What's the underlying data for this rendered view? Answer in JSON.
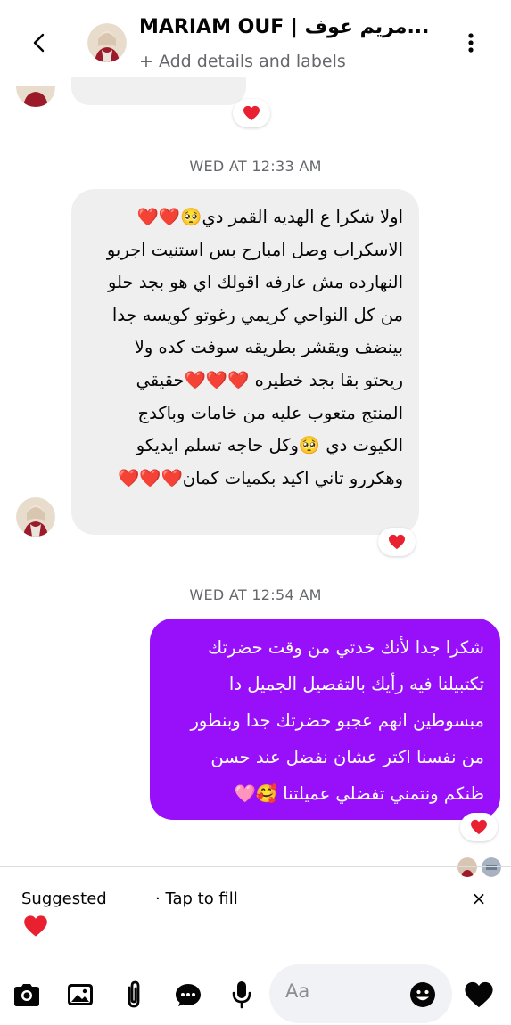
{
  "header": {
    "title": "MARIAM OUF | مريم عوف...",
    "subtitle": "+ Add details and labels"
  },
  "thread": {
    "timestamp_1": "WED AT 12:33 AM",
    "incoming_lines": [
      "اولا شكرا ع الهديه القمر دي🥺❤️❤️",
      "الاسكراب وصل امبارح بس استنيت اجربو",
      "النهارده مش عارفه اقولك اي هو بجد حلو",
      "من كل النواحي كريمي رغوتو كويسه جدا",
      "بينضف ويقشر  بطريقه سوفت كده ولا",
      "ريحتو بقا بجد خطيره ❤️❤️❤️حقيقي",
      "المنتج متعوب عليه من خامات وباكدج",
      "الكيوت دي 🥺وكل حاجه تسلم ايديكو",
      "وهكررو تاني اكيد بكميات كمان❤️❤️❤️"
    ],
    "timestamp_2": "WED AT 12:54 AM",
    "outgoing_lines": [
      "شكرا جدا لأنك خدتي من وقت حضرتك",
      "تكتبيلنا فيه رأيك بالتفصيل الجميل دا",
      "مبسوطين انهم عجبو حضرتك جدا وبنطور",
      "من نفسنا اكتر عشان نفضل عند حسن",
      "ظنكم ونتمني تفضلي عميلتنا 🥰🩷"
    ]
  },
  "suggestions": {
    "label": "Suggested",
    "tap_text": "· Tap to fill",
    "close": "×"
  },
  "composer": {
    "placeholder": "Aa"
  },
  "colors": {
    "outgoing_bubble": "#9810fa",
    "incoming_bubble": "#efefef",
    "heart": "#e8202f"
  },
  "icons": [
    "back-arrow-icon",
    "more-vertical-icon",
    "heart-icon",
    "camera-icon",
    "gallery-icon",
    "paperclip-icon",
    "chat-bubble-icon",
    "microphone-icon",
    "emoji-icon",
    "like-heart-icon",
    "close-icon"
  ]
}
